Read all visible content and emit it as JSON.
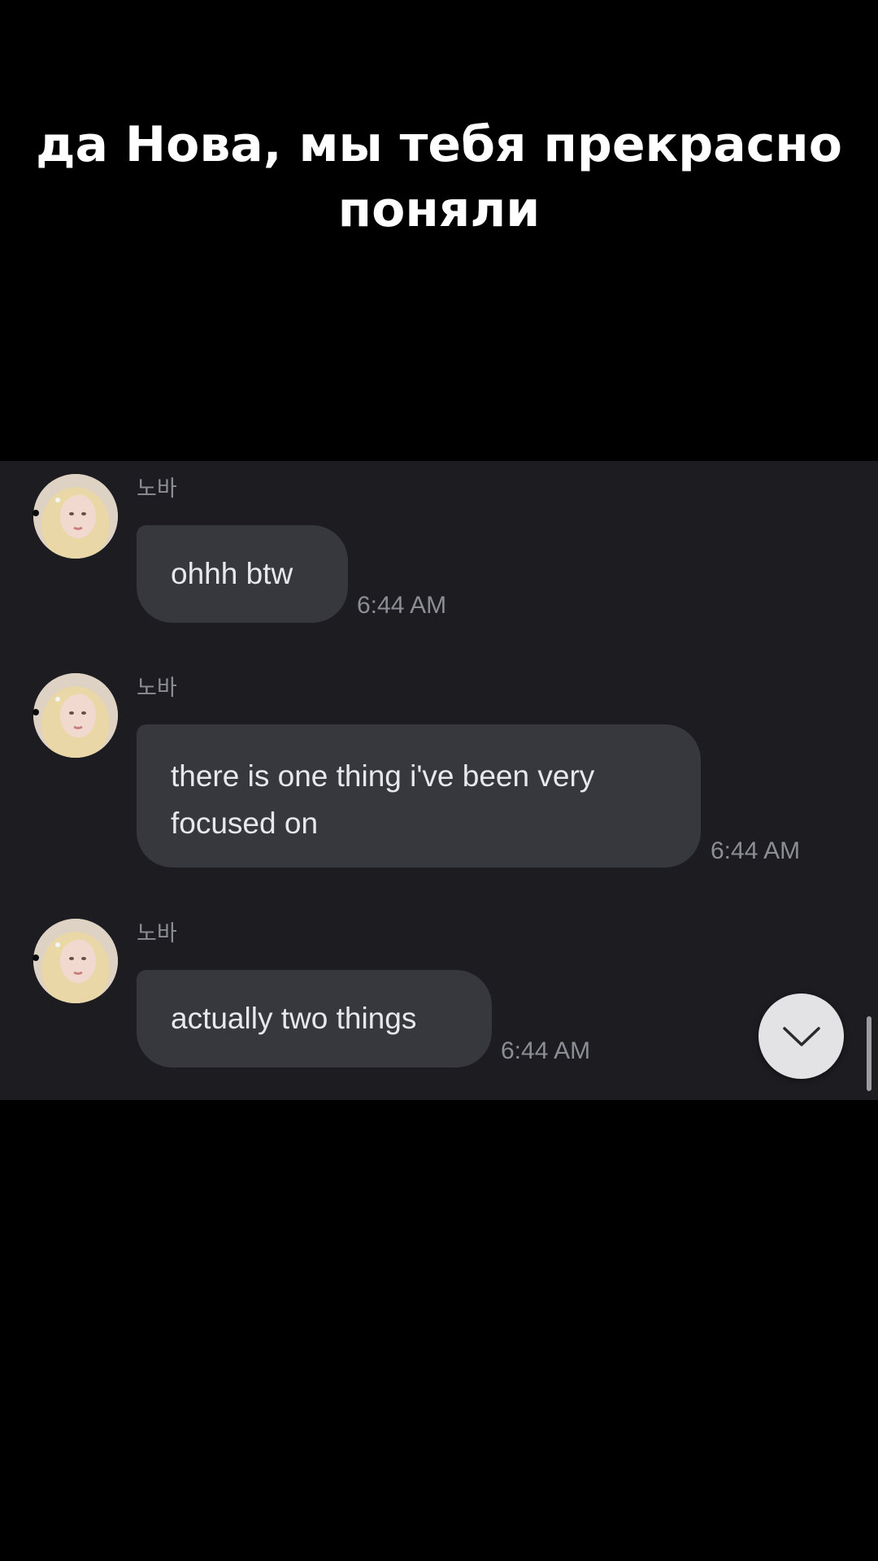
{
  "caption": {
    "line1": "да Нова, мы тебя прекрасно",
    "line2": "поняли"
  },
  "chat": {
    "sender_name": "노바",
    "messages": [
      {
        "sender": "노바",
        "lines": [
          "ohhh btw"
        ],
        "time": "6:44 AM"
      },
      {
        "sender": "노바",
        "lines": [
          "there is one thing i've been very",
          "focused on"
        ],
        "time": "6:44 AM"
      },
      {
        "sender": "노바",
        "lines": [
          "actually two things"
        ],
        "time": "6:44 AM"
      }
    ]
  },
  "icons": {
    "avatar": "profile-photo-avatar",
    "scroll_down": "chevron-down-icon"
  },
  "colors": {
    "background": "#000000",
    "chat_panel": "#1c1c21",
    "bubble": "#37373e",
    "bubble_text": "#e7e7ec",
    "muted_text": "#8d8d95",
    "scroll_button": "#e3e3e6"
  }
}
